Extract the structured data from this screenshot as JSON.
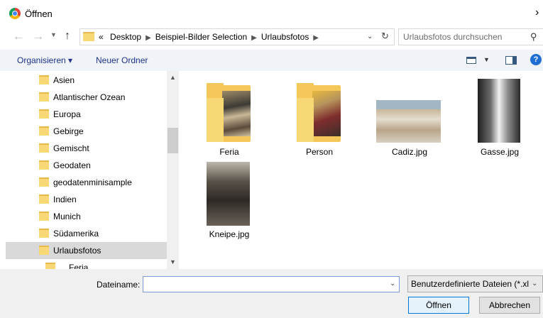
{
  "window": {
    "title": "Öffnen"
  },
  "address": {
    "crumb_prefix": "«",
    "crumbs": [
      "Desktop",
      "Beispiel-Bilder Selection",
      "Urlaubsfotos"
    ],
    "search_placeholder": "Urlaubsfotos durchsuchen"
  },
  "toolbar": {
    "organize_label": "Organisieren ▾",
    "new_folder_label": "Neuer Ordner"
  },
  "nav": {
    "items": [
      {
        "label": "Asien"
      },
      {
        "label": "Atlantischer Ozean"
      },
      {
        "label": "Europa"
      },
      {
        "label": "Gebirge"
      },
      {
        "label": "Gemischt"
      },
      {
        "label": "Geodaten"
      },
      {
        "label": "geodatenminisample"
      },
      {
        "label": "Indien"
      },
      {
        "label": "Munich"
      },
      {
        "label": "Südamerika"
      },
      {
        "label": "Urlaubsfotos"
      },
      {
        "label": "Feria"
      }
    ],
    "selected": "Urlaubsfotos"
  },
  "files": [
    {
      "name": "Feria",
      "kind": "folder"
    },
    {
      "name": "Person",
      "kind": "folder"
    },
    {
      "name": "Cadiz.jpg",
      "kind": "image"
    },
    {
      "name": "Gasse.jpg",
      "kind": "image"
    },
    {
      "name": "Kneipe.jpg",
      "kind": "image"
    }
  ],
  "bottom": {
    "filename_label": "Dateiname:",
    "filename_value": "",
    "filetype_value": "Benutzerdefinierte Dateien (*.xlsx)",
    "open_label": "Öffnen",
    "cancel_label": "Abbrechen"
  },
  "colors": {
    "link_blue": "#1e3287",
    "toolbar_bg": "#f0f4f9",
    "selected_bg": "#d9d9d9",
    "accent": "#0078d7"
  }
}
